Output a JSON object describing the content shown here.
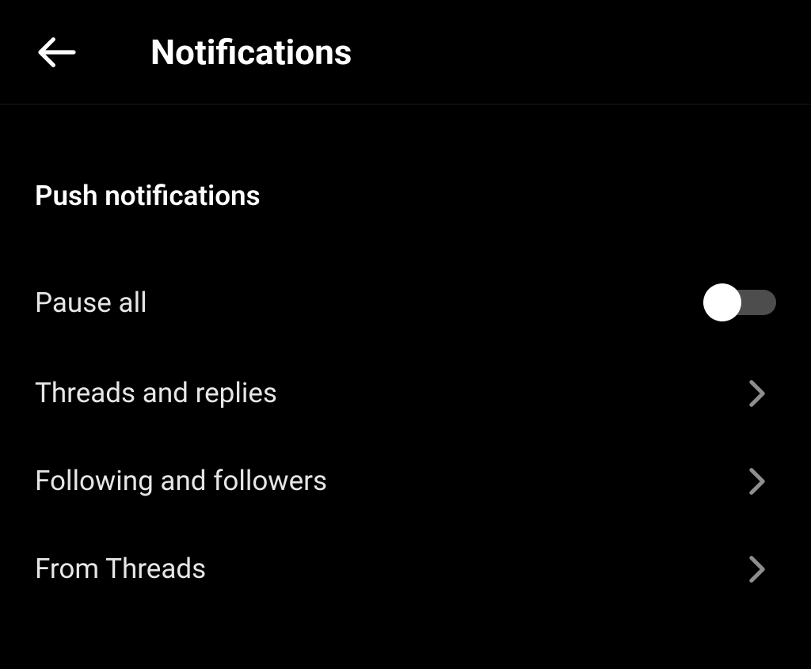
{
  "header": {
    "title": "Notifications"
  },
  "section": {
    "title": "Push notifications"
  },
  "rows": {
    "pause_all": {
      "label": "Pause all",
      "toggle": false
    },
    "threads_replies": {
      "label": "Threads and replies"
    },
    "following_followers": {
      "label": "Following and followers"
    },
    "from_threads": {
      "label": "From Threads"
    }
  }
}
